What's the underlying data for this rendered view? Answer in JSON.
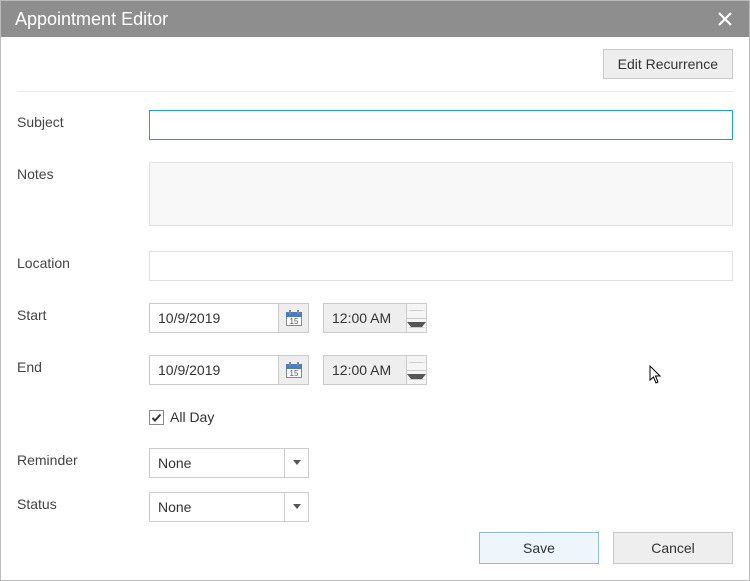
{
  "window": {
    "title": "Appointment Editor"
  },
  "toolbar": {
    "edit_recurrence": "Edit Recurrence"
  },
  "labels": {
    "subject": "Subject",
    "notes": "Notes",
    "location": "Location",
    "start": "Start",
    "end": "End",
    "all_day": "All Day",
    "reminder": "Reminder",
    "status": "Status"
  },
  "fields": {
    "subject": "",
    "notes": "",
    "location": "",
    "start_date": "10/9/2019",
    "start_time": "12:00 AM",
    "end_date": "10/9/2019",
    "end_time": "12:00 AM",
    "all_day_checked": true,
    "reminder": "None",
    "status": "None"
  },
  "buttons": {
    "save": "Save",
    "cancel": "Cancel"
  }
}
